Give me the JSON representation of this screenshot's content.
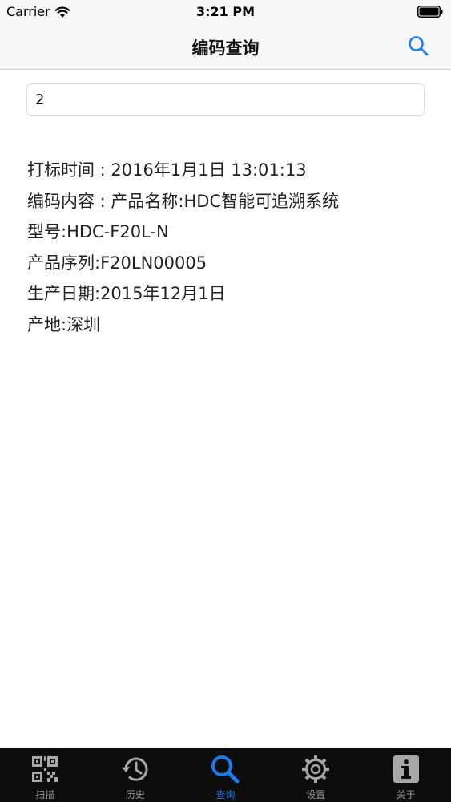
{
  "status_bar": {
    "carrier": "Carrier",
    "time": "3:21 PM",
    "wifi_icon": "wifi-icon",
    "battery_icon": "battery-icon"
  },
  "nav": {
    "title": "编码查询",
    "search_icon": "search-icon",
    "accent_color": "#1a7cf0"
  },
  "query": {
    "value": "2"
  },
  "result": {
    "lines": [
      "打标时间 : 2016年1月1日 13:01:13",
      "编码内容 : 产品名称:HDC智能可追溯系统",
      "型号:HDC-F20L-N",
      "产品序列:F20LN00005",
      "生产日期:2015年12月1日",
      "产地:深圳"
    ]
  },
  "tabs": [
    {
      "label": "扫描",
      "icon": "qr-code-icon",
      "active": false
    },
    {
      "label": "历史",
      "icon": "history-icon",
      "active": false
    },
    {
      "label": "查询",
      "icon": "search-icon",
      "active": true
    },
    {
      "label": "设置",
      "icon": "gear-icon",
      "active": false
    },
    {
      "label": "关于",
      "icon": "info-icon",
      "active": false
    }
  ],
  "colors": {
    "tab_bar_bg": "#0d0d0d",
    "tab_active": "#1a7cf0",
    "tab_inactive": "#9a9a9a"
  }
}
